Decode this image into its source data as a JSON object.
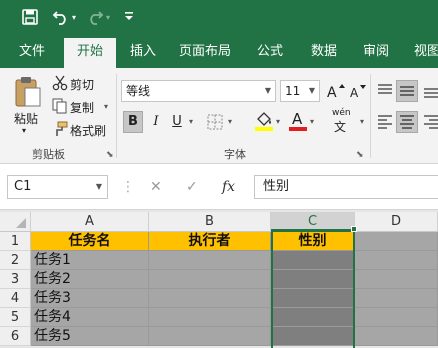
{
  "qat": {
    "icons": [
      "save-icon",
      "undo-icon",
      "redo-icon",
      "customize-icon"
    ]
  },
  "tabs": [
    "文件",
    "开始",
    "插入",
    "页面布局",
    "公式",
    "数据",
    "审阅",
    "视图"
  ],
  "active_tab": "开始",
  "clipboard": {
    "paste": "粘贴",
    "cut": "剪切",
    "copy": "复制",
    "format_painter": "格式刷",
    "group_label": "剪贴板"
  },
  "font": {
    "name": "等线",
    "size": "11",
    "bold": "B",
    "italic": "I",
    "underline": "U",
    "font_color_letter": "A",
    "pinyin": "wén",
    "group_label": "字体",
    "font_color": "#e02020",
    "fill_color": "#ffff00"
  },
  "formula_bar": {
    "cell_ref": "C1",
    "fx": "fx",
    "content": "性别"
  },
  "sheet": {
    "columns": [
      "A",
      "B",
      "C",
      "D"
    ],
    "rows": [
      "1",
      "2",
      "3",
      "4",
      "5",
      "6"
    ],
    "cells": [
      [
        "任务名",
        "执行者",
        "性别",
        ""
      ],
      [
        "任务1",
        "",
        "",
        ""
      ],
      [
        "任务2",
        "",
        "",
        ""
      ],
      [
        "任务3",
        "",
        "",
        ""
      ],
      [
        "任务4",
        "",
        "",
        ""
      ],
      [
        "任务5",
        "",
        "",
        ""
      ]
    ],
    "selected_column": "C",
    "header_fill": "#ffc000"
  }
}
